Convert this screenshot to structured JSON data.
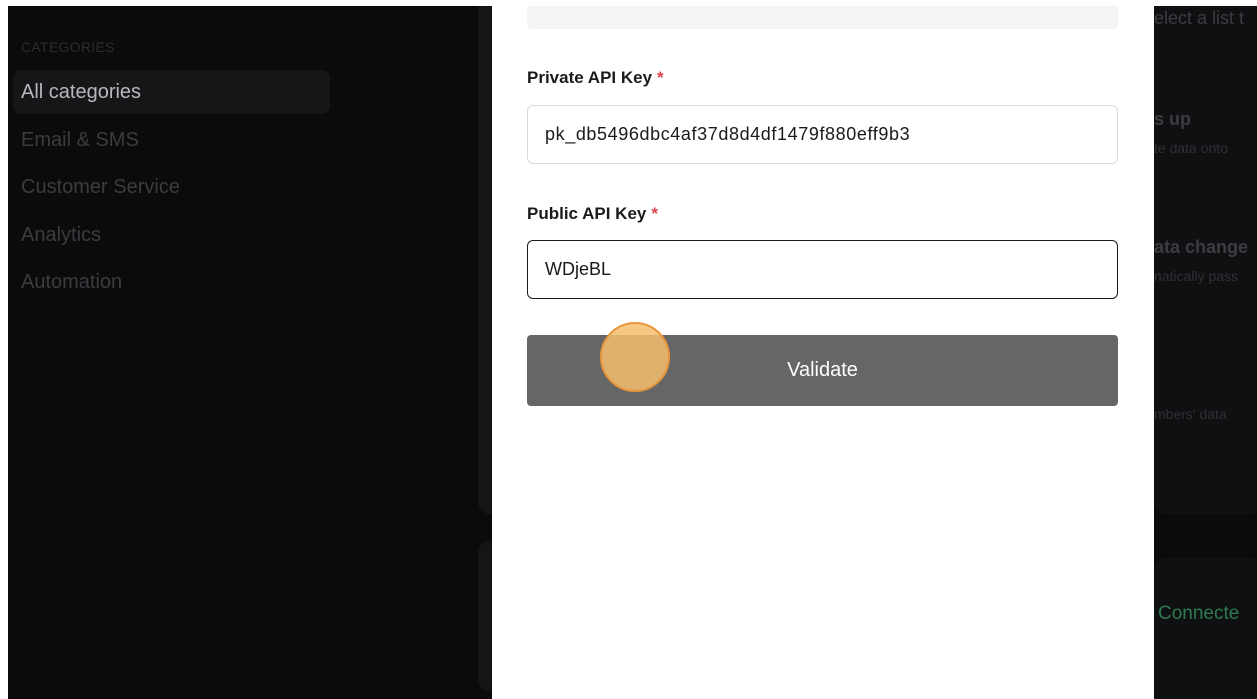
{
  "sidebar": {
    "title": "CATEGORIES",
    "items": [
      {
        "label": "All categories",
        "active": true
      },
      {
        "label": "Email & SMS",
        "active": false
      },
      {
        "label": "Customer Service",
        "active": false
      },
      {
        "label": "Analytics",
        "active": false
      },
      {
        "label": "Automation",
        "active": false
      }
    ]
  },
  "modal": {
    "private_key": {
      "label": "Private API Key",
      "required_mark": "*",
      "value": "pk_db5496dbc4af37d8d4df1479f880eff9b3"
    },
    "public_key": {
      "label": "Public API Key",
      "required_mark": "*",
      "value": "WDjeBL"
    },
    "validate_label": "Validate"
  },
  "background_right": {
    "select_list": "elect a list t",
    "heading_1": "s up",
    "desc_1": "te data onto",
    "heading_2": "ata change",
    "desc_2": "natically pass",
    "desc_3": "mbers' data",
    "status": "Connecte"
  },
  "colors": {
    "required": "#e0434e",
    "button": "#666666",
    "connected": "#2f7a4f",
    "click_marker": "#f4be6e"
  }
}
